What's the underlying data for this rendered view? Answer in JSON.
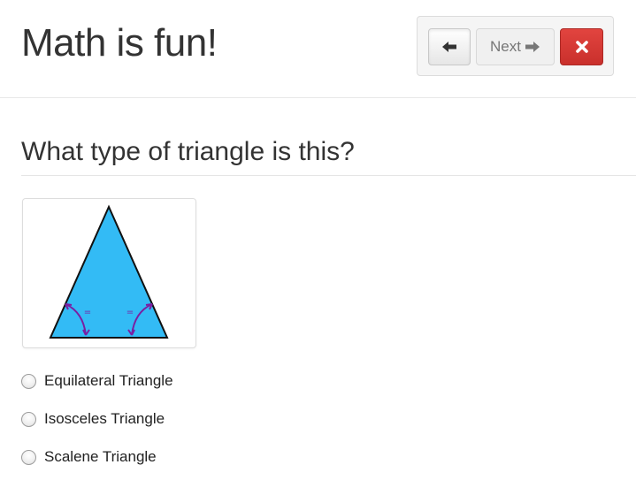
{
  "header": {
    "title": "Math is fun!",
    "toolbar": {
      "back_icon": "arrow-left-icon",
      "next_label": "Next",
      "next_icon": "arrow-right-icon",
      "close_icon": "close-icon"
    }
  },
  "question": {
    "title": "What type of triangle is this?",
    "image": {
      "fill_color": "#33bbf5",
      "angle_mark_color": "#7a1fa2",
      "angle_marks": [
        "=",
        "="
      ]
    },
    "options": [
      {
        "label": "Equilateral Triangle",
        "selected": false
      },
      {
        "label": "Isosceles Triangle",
        "selected": false
      },
      {
        "label": "Scalene Triangle",
        "selected": false
      }
    ]
  },
  "colors": {
    "danger": "#d9534f",
    "text": "#333333"
  }
}
